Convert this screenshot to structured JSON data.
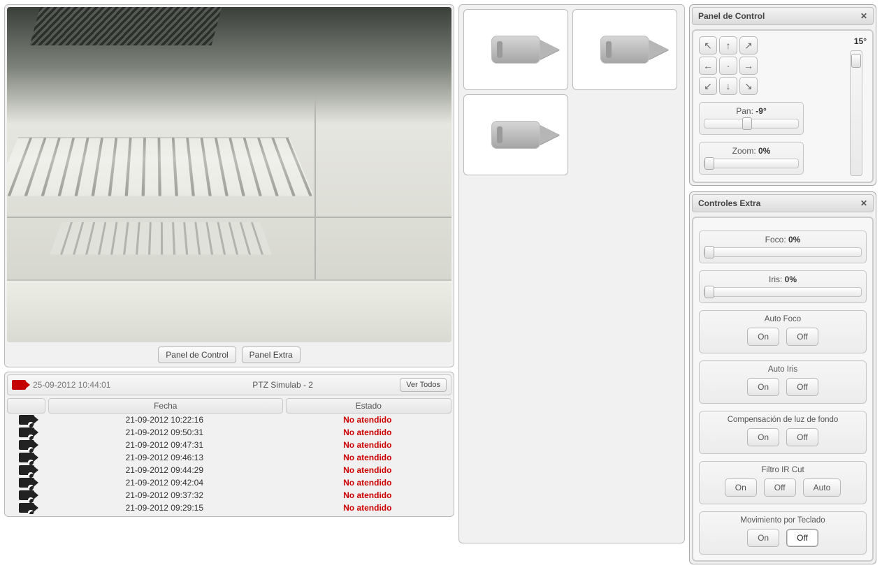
{
  "toggles": {
    "panel_control": "Panel de Control",
    "panel_extra": "Panel Extra"
  },
  "events": {
    "timestamp": "25-09-2012 10:44:01",
    "camera_name": "PTZ Simulab - 2",
    "view_all": "Ver Todos",
    "columns": {
      "date": "Fecha",
      "state": "Estado"
    },
    "status_unattended": "No atendido",
    "rows": [
      {
        "date": "21-09-2012 10:22:16"
      },
      {
        "date": "21-09-2012 09:50:31"
      },
      {
        "date": "21-09-2012 09:47:31"
      },
      {
        "date": "21-09-2012 09:46:13"
      },
      {
        "date": "21-09-2012 09:44:29"
      },
      {
        "date": "21-09-2012 09:42:04"
      },
      {
        "date": "21-09-2012 09:37:32"
      },
      {
        "date": "21-09-2012 09:29:15"
      }
    ]
  },
  "control_panel": {
    "title": "Panel de Control",
    "tilt_label": "15°",
    "pan_label": "Pan: ",
    "pan_value": "-9°",
    "pan_percent": 45,
    "zoom_label": "Zoom: ",
    "zoom_value": "0%",
    "zoom_percent": 0
  },
  "extra_panel": {
    "title": "Controles Extra",
    "focus_label": "Foco: ",
    "focus_value": "0%",
    "focus_percent": 0,
    "iris_label": "Iris: ",
    "iris_value": "0%",
    "iris_percent": 0,
    "on": "On",
    "off": "Off",
    "auto": "Auto",
    "groups": {
      "auto_focus": "Auto Foco",
      "auto_iris": "Auto Iris",
      "backlight": "Compensación de luz de fondo",
      "ircut": "Filtro IR Cut",
      "keyboard": "Movimiento por Teclado"
    }
  }
}
